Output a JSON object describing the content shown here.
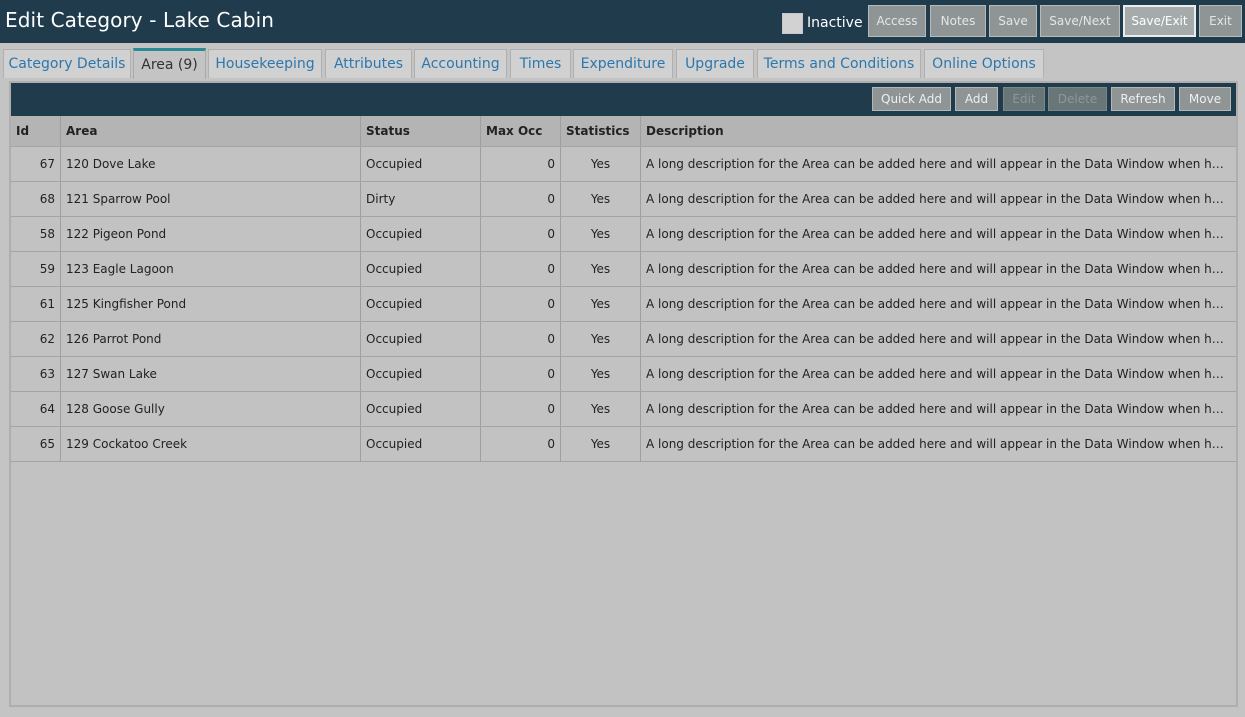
{
  "header": {
    "title": "Edit Category - Lake Cabin",
    "inactive_label": "Inactive",
    "buttons": {
      "access": "Access",
      "notes": "Notes",
      "save": "Save",
      "save_next": "Save/Next",
      "save_exit": "Save/Exit",
      "exit": "Exit"
    }
  },
  "tabs": [
    "Category Details",
    "Area (9)",
    "Housekeeping",
    "Attributes",
    "Accounting",
    "Times",
    "Expenditure",
    "Upgrade",
    "Terms and Conditions",
    "Online Options"
  ],
  "active_tab": "Area (9)",
  "toolbar": {
    "quick_add": "Quick Add",
    "add": "Add",
    "edit": "Edit",
    "delete": "Delete",
    "refresh": "Refresh",
    "move": "Move"
  },
  "table": {
    "columns": {
      "id": "Id",
      "area": "Area",
      "status": "Status",
      "max_occ": "Max Occ",
      "statistics": "Statistics",
      "description": "Description"
    },
    "rows": [
      {
        "id": "67",
        "area": "120 Dove Lake",
        "status": "Occupied",
        "max_occ": "0",
        "statistics": "Yes",
        "description": "A long description for the Area can be added here and will appear in the Data Window when hovering ..."
      },
      {
        "id": "68",
        "area": "121 Sparrow Pool",
        "status": "Dirty",
        "max_occ": "0",
        "statistics": "Yes",
        "description": "A long description for the Area can be added here and will appear in the Data Window when hovering ..."
      },
      {
        "id": "58",
        "area": "122 Pigeon Pond",
        "status": "Occupied",
        "max_occ": "0",
        "statistics": "Yes",
        "description": "A long description for the Area can be added here and will appear in the Data Window when hovering ..."
      },
      {
        "id": "59",
        "area": "123 Eagle Lagoon",
        "status": "Occupied",
        "max_occ": "0",
        "statistics": "Yes",
        "description": "A long description for the Area can be added here and will appear in the Data Window when hovering ..."
      },
      {
        "id": "61",
        "area": "125 Kingfisher Pond",
        "status": "Occupied",
        "max_occ": "0",
        "statistics": "Yes",
        "description": "A long description for the Area can be added here and will appear in the Data Window when hovering ..."
      },
      {
        "id": "62",
        "area": "126 Parrot Pond",
        "status": "Occupied",
        "max_occ": "0",
        "statistics": "Yes",
        "description": "A long description for the Area can be added here and will appear in the Data Window when hovering ..."
      },
      {
        "id": "63",
        "area": "127 Swan Lake",
        "status": "Occupied",
        "max_occ": "0",
        "statistics": "Yes",
        "description": "A long description for the Area can be added here and will appear in the Data Window when hovering ..."
      },
      {
        "id": "64",
        "area": "128 Goose Gully",
        "status": "Occupied",
        "max_occ": "0",
        "statistics": "Yes",
        "description": "A long description for the Area can be added here and will appear in the Data Window when hovering ..."
      },
      {
        "id": "65",
        "area": "129 Cockatoo Creek",
        "status": "Occupied",
        "max_occ": "0",
        "statistics": "Yes",
        "description": "A long description for the Area can be added here and will appear in the Data Window when hovering ..."
      }
    ]
  }
}
